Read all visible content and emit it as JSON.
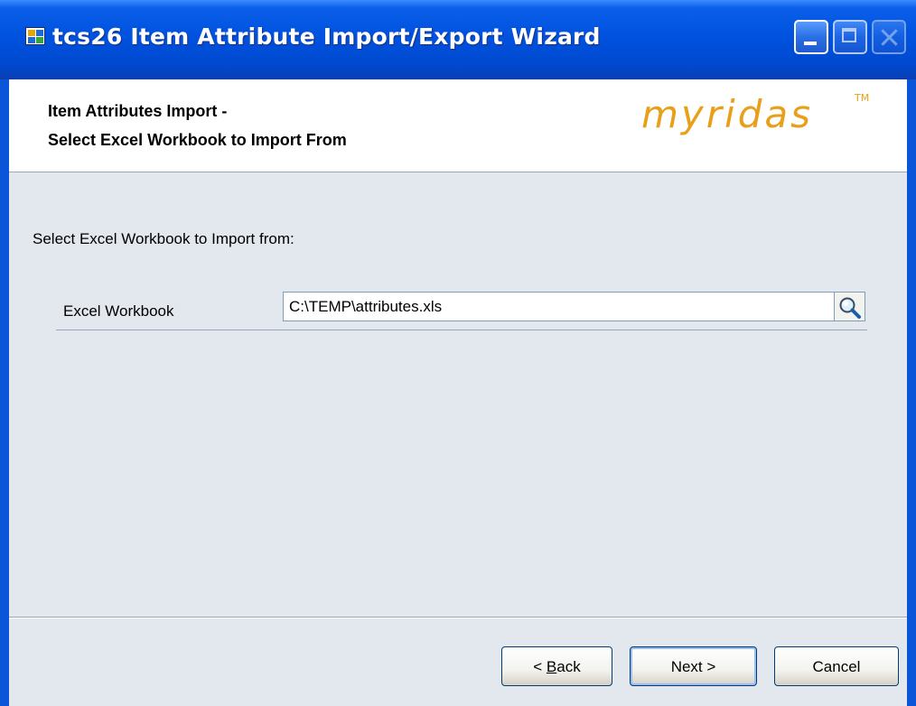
{
  "window": {
    "title": "tcs26 Item Attribute Import/Export Wizard",
    "icon": "app-icon",
    "controls": [
      "minimize-icon",
      "maximize-icon",
      "close-icon"
    ]
  },
  "header": {
    "line1": "Item Attributes Import -",
    "line2": "Select Excel Workbook to Import From",
    "brand": "myridas",
    "trademark": "TM"
  },
  "body": {
    "prompt": "Select Excel Workbook to Import from:",
    "field": {
      "label": "Excel Workbook",
      "value": "C:\\TEMP\\attributes.xls",
      "lookup_icon": "magnifier-icon"
    }
  },
  "buttons": {
    "back_prefix": "< ",
    "back_mnemonic": "B",
    "back_rest": "ack",
    "next": "Next >",
    "cancel": "Cancel"
  },
  "colors": {
    "titlebar": "#0052df",
    "brand": "#e8a01a",
    "client_bg": "#e3e7ee"
  }
}
